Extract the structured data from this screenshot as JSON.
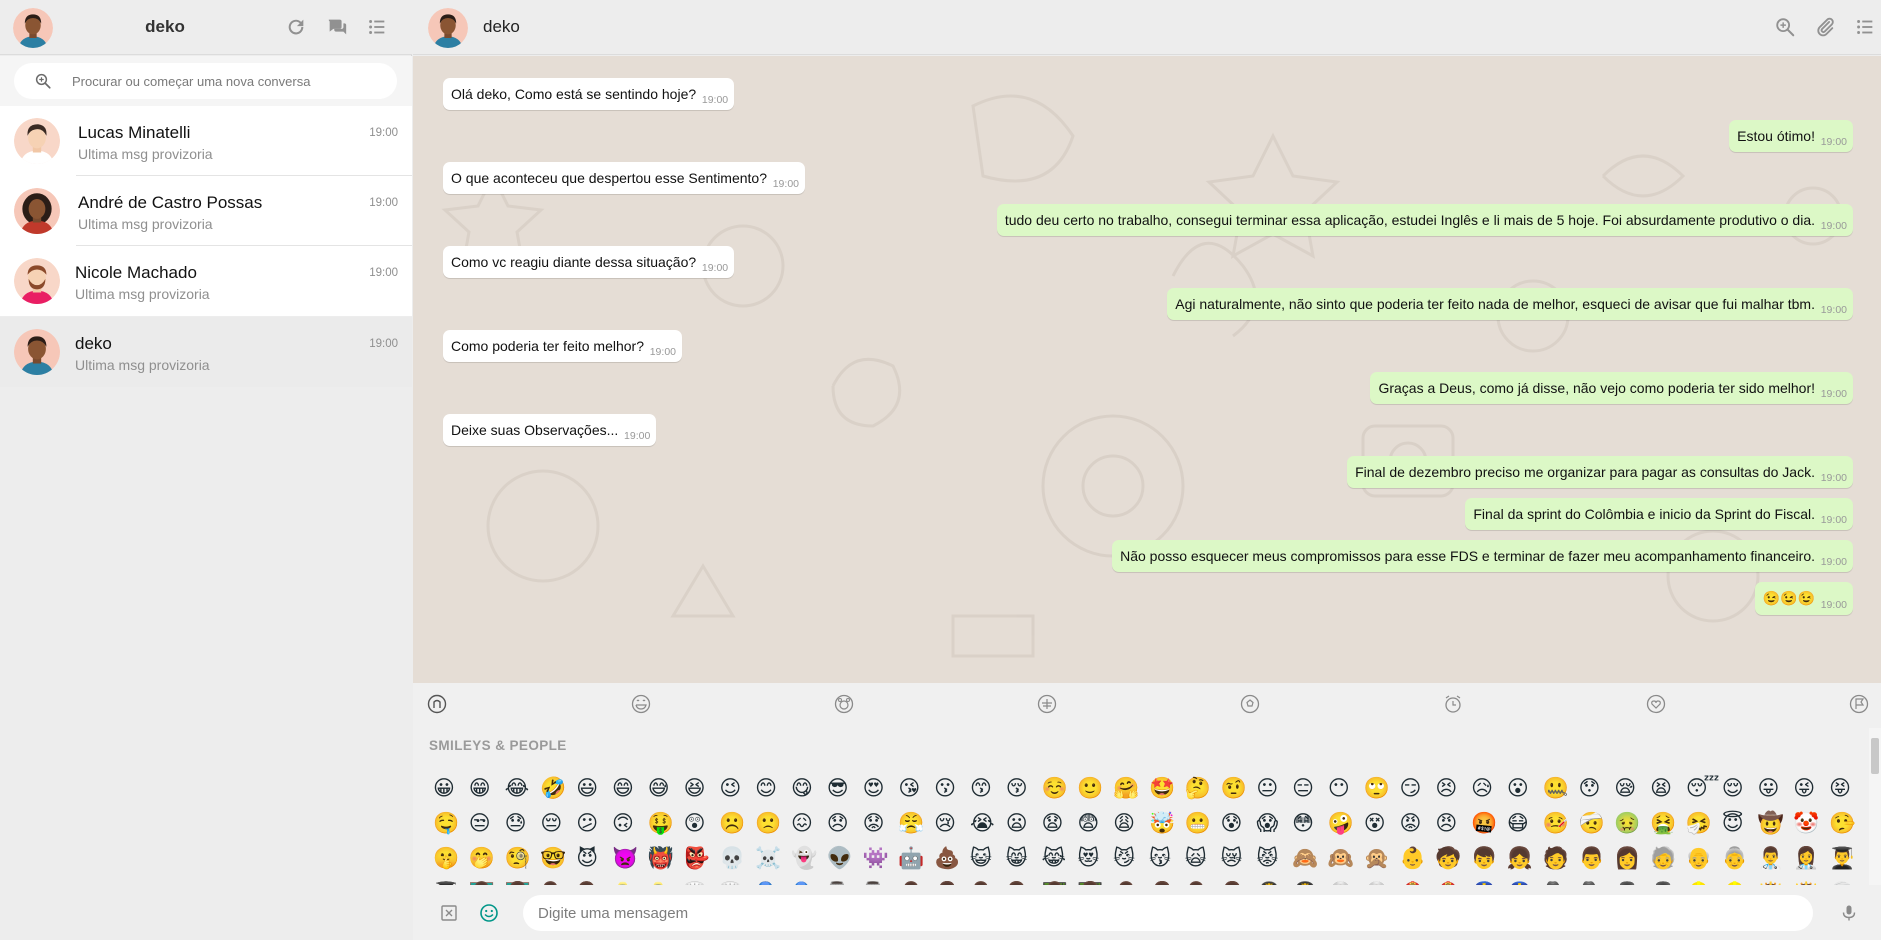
{
  "app": {
    "current_user": "deko"
  },
  "sidebar": {
    "title": "deko",
    "icons": [
      "refresh-icon",
      "chat-bubbles-icon",
      "menu-list-icon"
    ],
    "search": {
      "placeholder": "Procurar ou começar uma nova conversa",
      "value": ""
    },
    "chats": [
      {
        "name": "Lucas Minatelli",
        "last": "Ultima msg provizoria",
        "time": "19:00",
        "active": false
      },
      {
        "name": "André de Castro Possas",
        "last": "Ultima msg provizoria",
        "time": "19:00",
        "active": false
      },
      {
        "name": "Nicole Machado",
        "last": "Ultima msg provizoria",
        "time": "19:00",
        "active": false
      },
      {
        "name": "deko",
        "last": "Ultima msg provizoria",
        "time": "19:00",
        "active": true
      }
    ]
  },
  "conversation": {
    "name": "deko",
    "icons": [
      "search-icon",
      "attach-icon",
      "menu-list-icon"
    ],
    "messages": [
      {
        "dir": "in",
        "text": "Olá deko, Como está se sentindo hoje?",
        "time": "19:00"
      },
      {
        "dir": "out",
        "text": "Estou ótimo!",
        "time": "19:00"
      },
      {
        "dir": "in",
        "text": "O que aconteceu que despertou esse Sentimento?",
        "time": "19:00"
      },
      {
        "dir": "out",
        "text": "tudo deu certo no trabalho, consegui terminar essa aplicação, estudei Inglês e li mais de 5 hoje. Foi absurdamente produtivo o dia.",
        "time": "19:00"
      },
      {
        "dir": "in",
        "text": "Como vc reagiu diante dessa situação?",
        "time": "19:00"
      },
      {
        "dir": "out",
        "text": "Agi naturalmente, não sinto que poderia ter feito nada de melhor, esqueci de avisar que fui malhar tbm.",
        "time": "19:00"
      },
      {
        "dir": "in",
        "text": "Como poderia ter feito melhor?",
        "time": "19:00"
      },
      {
        "dir": "out",
        "text": "Graças a Deus, como já disse, não vejo como poderia ter sido melhor!",
        "time": "19:00"
      },
      {
        "dir": "in",
        "text": "Deixe suas Observações...",
        "time": "19:00"
      },
      {
        "dir": "out",
        "text": "Final de dezembro preciso me organizar para pagar as consultas do Jack.",
        "time": "19:00"
      },
      {
        "dir": "out",
        "text": "Final da sprint do Colômbia e inicio da Sprint do Fiscal.",
        "time": "19:00"
      },
      {
        "dir": "out",
        "text": "Não posso esquecer meus compromissos para esse FDS e terminar de fazer meu acompanhamento financeiro.",
        "time": "19:00"
      },
      {
        "dir": "out",
        "text": "😉😉😉",
        "time": "19:00"
      }
    ]
  },
  "emoji_panel": {
    "tabs": [
      "recent-icon",
      "smiley-icon",
      "animal-icon",
      "food-icon",
      "activity-icon",
      "travel-icon",
      "objects-icon",
      "symbols-icon",
      "flags-icon"
    ],
    "category_title": "SMILEYS & PEOPLE",
    "rows": [
      [
        "😀",
        "😁",
        "😂",
        "🤣",
        "😃",
        "😄",
        "😅",
        "😆",
        "😉",
        "😊",
        "😋",
        "😎",
        "😍",
        "😘",
        "😗",
        "😙",
        "😚",
        "☺️",
        "🙂",
        "🤗",
        "🤩",
        "🤔",
        "🤨",
        "😐",
        "😑",
        "😶",
        "🙄",
        "😏",
        "😣",
        "😥",
        "😮",
        "🤐",
        "😯",
        "😪",
        "😫",
        "😴",
        "😌",
        "😛",
        "😜",
        "😝"
      ],
      [
        "🤤",
        "😒",
        "😓",
        "😔",
        "😕",
        "🙃",
        "🤑",
        "😲",
        "☹️",
        "🙁",
        "😖",
        "😞",
        "😟",
        "😤",
        "😢",
        "😭",
        "😦",
        "😧",
        "😨",
        "😩",
        "🤯",
        "😬",
        "😰",
        "😱",
        "😳",
        "🤪",
        "😵",
        "😡",
        "😠",
        "🤬",
        "😷",
        "🤒",
        "🤕",
        "🤢",
        "🤮",
        "🤧",
        "😇",
        "🤠",
        "🤡",
        "🤥"
      ],
      [
        "🤫",
        "🤭",
        "🧐",
        "🤓",
        "😈",
        "👿",
        "👹",
        "👺",
        "💀",
        "☠️",
        "👻",
        "👽",
        "👾",
        "🤖",
        "💩",
        "😺",
        "😸",
        "😹",
        "😻",
        "😼",
        "😽",
        "🙀",
        "😿",
        "😾",
        "🙈",
        "🙉",
        "🙊",
        "👶",
        "🧒",
        "👦",
        "👧",
        "🧑",
        "👨",
        "👩",
        "🧓",
        "👴",
        "👵",
        "👨‍⚕️",
        "👩‍⚕️",
        "👨‍🎓"
      ],
      [
        "👩‍🎓",
        "👨‍🏫",
        "👩‍🏫",
        "👨‍⚖️",
        "👩‍⚖️",
        "👨‍🌾",
        "👩‍🌾",
        "👨‍🍳",
        "👩‍🍳",
        "👨‍🔧",
        "👩‍🔧",
        "👨‍🏭",
        "👩‍🏭",
        "👨‍💼",
        "👩‍💼",
        "👨‍🔬",
        "👩‍🔬",
        "👨‍💻",
        "👩‍💻",
        "👨‍🎤",
        "👩‍🎤",
        "👨‍🎨",
        "👩‍🎨",
        "👨‍✈️",
        "👩‍✈️",
        "👨‍🚀",
        "👩‍🚀",
        "👨‍🚒",
        "👩‍🚒",
        "👮",
        "👮‍♀️",
        "🕵️",
        "🕵️‍♀️",
        "💂",
        "💂‍♀️",
        "👷",
        "👷‍♀️",
        "🤴",
        "👸",
        "👳"
      ]
    ]
  },
  "compose": {
    "placeholder": "Digite uma mensagem",
    "value": "",
    "icons": [
      "close-box-icon",
      "emoji-icon",
      "microphone-icon"
    ]
  },
  "colors": {
    "incoming_bubble": "#ffffff",
    "outgoing_bubble": "#dcf8c6",
    "chat_background": "#e5ddd5",
    "panel_background": "#ededed",
    "accent": "#009688"
  }
}
